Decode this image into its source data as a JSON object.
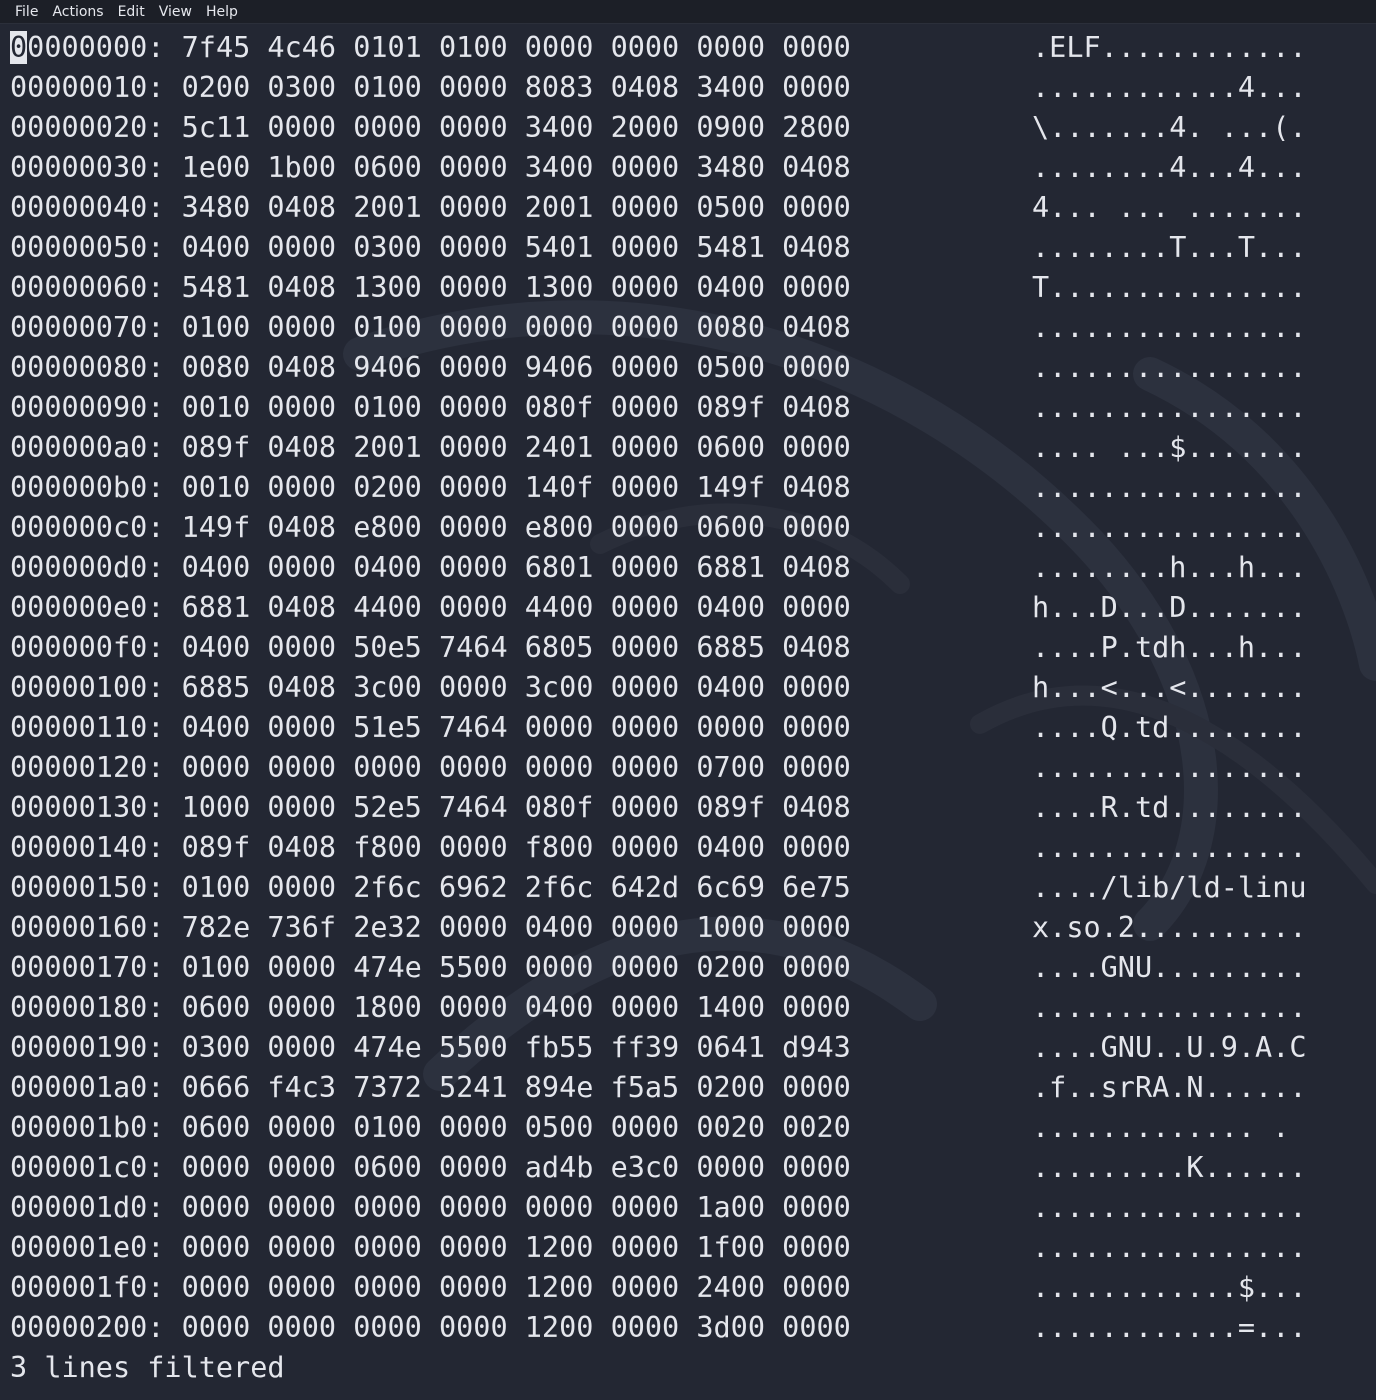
{
  "menubar": {
    "items": [
      "File",
      "Actions",
      "Edit",
      "View",
      "Help"
    ]
  },
  "dump": {
    "lines": [
      {
        "off": "00000000:",
        "hex": "7f45 4c46 0101 0100 0000 0000 0000 0000",
        "ascii": ".ELF............"
      },
      {
        "off": "00000010:",
        "hex": "0200 0300 0100 0000 8083 0408 3400 0000",
        "ascii": "............4..."
      },
      {
        "off": "00000020:",
        "hex": "5c11 0000 0000 0000 3400 2000 0900 2800",
        "ascii": "\\.......4. ...(."
      },
      {
        "off": "00000030:",
        "hex": "1e00 1b00 0600 0000 3400 0000 3480 0408",
        "ascii": "........4...4..."
      },
      {
        "off": "00000040:",
        "hex": "3480 0408 2001 0000 2001 0000 0500 0000",
        "ascii": "4... ... ......."
      },
      {
        "off": "00000050:",
        "hex": "0400 0000 0300 0000 5401 0000 5481 0408",
        "ascii": "........T...T..."
      },
      {
        "off": "00000060:",
        "hex": "5481 0408 1300 0000 1300 0000 0400 0000",
        "ascii": "T..............."
      },
      {
        "off": "00000070:",
        "hex": "0100 0000 0100 0000 0000 0000 0080 0408",
        "ascii": "................"
      },
      {
        "off": "00000080:",
        "hex": "0080 0408 9406 0000 9406 0000 0500 0000",
        "ascii": "................"
      },
      {
        "off": "00000090:",
        "hex": "0010 0000 0100 0000 080f 0000 089f 0408",
        "ascii": "................"
      },
      {
        "off": "000000a0:",
        "hex": "089f 0408 2001 0000 2401 0000 0600 0000",
        "ascii": ".... ...$......."
      },
      {
        "off": "000000b0:",
        "hex": "0010 0000 0200 0000 140f 0000 149f 0408",
        "ascii": "................"
      },
      {
        "off": "000000c0:",
        "hex": "149f 0408 e800 0000 e800 0000 0600 0000",
        "ascii": "................"
      },
      {
        "off": "000000d0:",
        "hex": "0400 0000 0400 0000 6801 0000 6881 0408",
        "ascii": "........h...h..."
      },
      {
        "off": "000000e0:",
        "hex": "6881 0408 4400 0000 4400 0000 0400 0000",
        "ascii": "h...D...D......."
      },
      {
        "off": "000000f0:",
        "hex": "0400 0000 50e5 7464 6805 0000 6885 0408",
        "ascii": "....P.tdh...h..."
      },
      {
        "off": "00000100:",
        "hex": "6885 0408 3c00 0000 3c00 0000 0400 0000",
        "ascii": "h...<...<......."
      },
      {
        "off": "00000110:",
        "hex": "0400 0000 51e5 7464 0000 0000 0000 0000",
        "ascii": "....Q.td........"
      },
      {
        "off": "00000120:",
        "hex": "0000 0000 0000 0000 0000 0000 0700 0000",
        "ascii": "................"
      },
      {
        "off": "00000130:",
        "hex": "1000 0000 52e5 7464 080f 0000 089f 0408",
        "ascii": "....R.td........"
      },
      {
        "off": "00000140:",
        "hex": "089f 0408 f800 0000 f800 0000 0400 0000",
        "ascii": "................"
      },
      {
        "off": "00000150:",
        "hex": "0100 0000 2f6c 6962 2f6c 642d 6c69 6e75",
        "ascii": "..../lib/ld-linu"
      },
      {
        "off": "00000160:",
        "hex": "782e 736f 2e32 0000 0400 0000 1000 0000",
        "ascii": "x.so.2.........."
      },
      {
        "off": "00000170:",
        "hex": "0100 0000 474e 5500 0000 0000 0200 0000",
        "ascii": "....GNU........."
      },
      {
        "off": "00000180:",
        "hex": "0600 0000 1800 0000 0400 0000 1400 0000",
        "ascii": "................"
      },
      {
        "off": "00000190:",
        "hex": "0300 0000 474e 5500 fb55 ff39 0641 d943",
        "ascii": "....GNU..U.9.A.C"
      },
      {
        "off": "000001a0:",
        "hex": "0666 f4c3 7372 5241 894e f5a5 0200 0000",
        "ascii": ".f..srRA.N......"
      },
      {
        "off": "000001b0:",
        "hex": "0600 0000 0100 0000 0500 0000 0020 0020",
        "ascii": "............. . "
      },
      {
        "off": "000001c0:",
        "hex": "0000 0000 0600 0000 ad4b e3c0 0000 0000",
        "ascii": ".........K......"
      },
      {
        "off": "000001d0:",
        "hex": "0000 0000 0000 0000 0000 0000 1a00 0000",
        "ascii": "................"
      },
      {
        "off": "000001e0:",
        "hex": "0000 0000 0000 0000 1200 0000 1f00 0000",
        "ascii": "................"
      },
      {
        "off": "000001f0:",
        "hex": "0000 0000 0000 0000 1200 0000 2400 0000",
        "ascii": "............$..."
      },
      {
        "off": "00000200:",
        "hex": "0000 0000 0000 0000 1200 0000 3d00 0000",
        "ascii": "............=..."
      }
    ],
    "status": "3 lines filtered"
  },
  "colors": {
    "background": "#232733",
    "text": "#e4e6ec",
    "menubar": "#1c1f27"
  }
}
